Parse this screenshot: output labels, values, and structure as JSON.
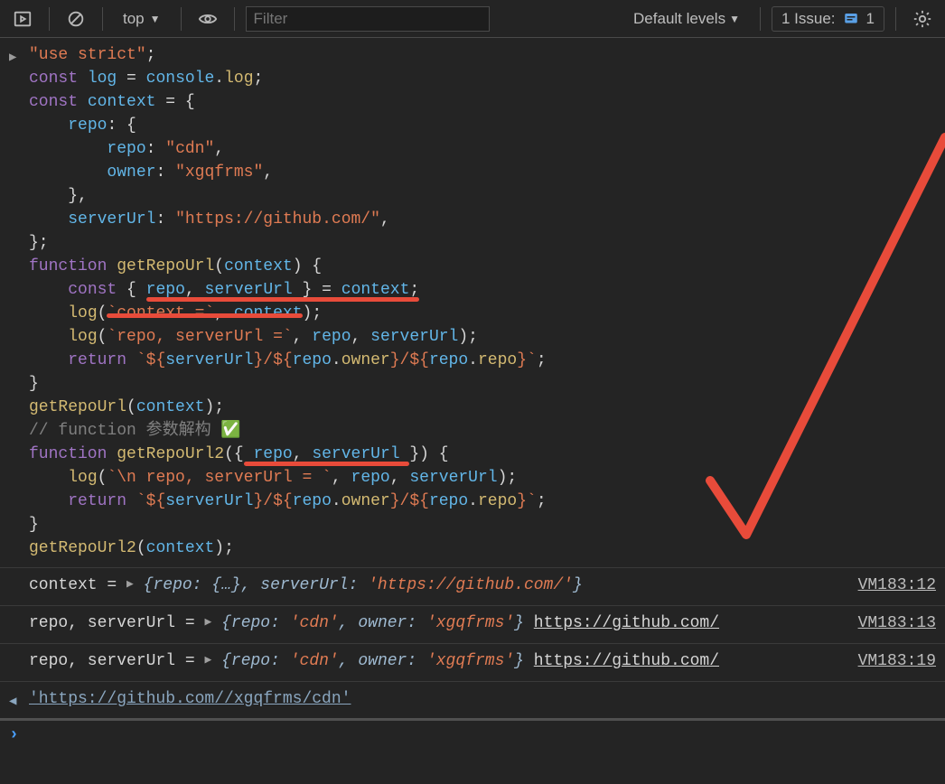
{
  "toolbar": {
    "context_selector": "top",
    "filter_placeholder": "Filter",
    "levels_label": "Default levels",
    "issues_label": "1 Issue:",
    "issues_count": "1"
  },
  "code": {
    "line1": "\"use strict\"",
    "log_var": "log",
    "console_log": "console",
    "log_prop": "log",
    "context_var": "context",
    "repo_key": "repo",
    "cdn_val": "\"cdn\"",
    "owner_key": "owner",
    "owner_val": "\"xgqfrms\"",
    "serverUrl_key": "serverUrl",
    "serverUrl_val": "\"https://github.com/\"",
    "fn1": "getRepoUrl",
    "fn2": "getRepoUrl2",
    "destruct_repo": "repo",
    "destruct_surl": "serverUrl",
    "ctx_ident": "context",
    "log_ctx_tpl": "`context =`",
    "log_rs_tpl": "`repo, serverUrl =`",
    "ret_tpl_a": "`${",
    "ret_tpl_b": "}/${",
    "ret_tpl_c": "}`",
    "repo_owner": "owner",
    "repo_repo": "repo",
    "comment": "// function 参数解构 ✅",
    "log_rs2_tpl": "`\\n repo, serverUrl = `"
  },
  "out": {
    "r1_prefix": "context =",
    "r1_obj_a": "{repo: {…}, serverUrl: ",
    "r1_obj_url": "'https://github.com/'",
    "r1_obj_b": "}",
    "r1_src": "VM183:12",
    "r2_prefix": "repo, serverUrl =",
    "r2_obj_a": "{repo: ",
    "r2_cdn": "'cdn'",
    "r2_mid": ", owner: ",
    "r2_owner": "'xgqfrms'",
    "r2_close": "}",
    "r2_link": "https://github.com/",
    "r2_src": "VM183:13",
    "r3_prefix": " repo, serverUrl =",
    "r3_src": "VM183:19",
    "ret_val": "'https://github.com//xgqfrms/cdn'"
  }
}
